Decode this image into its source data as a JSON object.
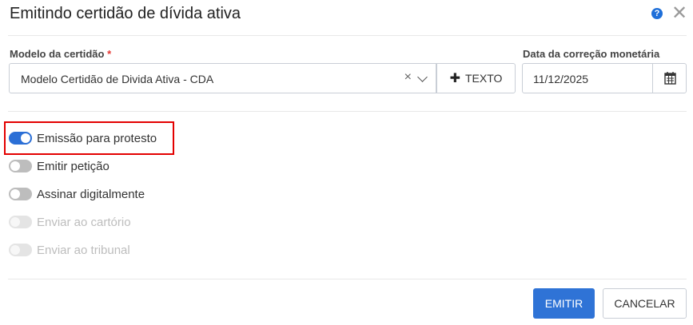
{
  "dialog": {
    "title": "Emitindo certidão de dívida ativa",
    "help_icon": "question-circle-icon",
    "close_icon": "close-icon"
  },
  "form": {
    "modelo_label": "Modelo da certidão",
    "required_mark": "*",
    "modelo_value": "Modelo Certidão de Divida Ativa - CDA",
    "clear_icon": "×",
    "texto_button": "TEXTO",
    "data_label": "Data da correção monetária",
    "data_value": "11/12/2025",
    "calendar_icon": "calendar-icon"
  },
  "toggles": [
    {
      "label": "Emissão para protesto",
      "state": "on",
      "enabled": true
    },
    {
      "label": "Emitir petição",
      "state": "off",
      "enabled": true
    },
    {
      "label": "Assinar digitalmente",
      "state": "off",
      "enabled": true
    },
    {
      "label": "Enviar ao cartório",
      "state": "off",
      "enabled": false
    },
    {
      "label": "Enviar ao tribunal",
      "state": "off",
      "enabled": false
    }
  ],
  "footer": {
    "emitir_label": "EMITIR",
    "cancelar_label": "CANCELAR"
  },
  "colors": {
    "primary": "#2f73d6",
    "highlight_border": "#e30000",
    "required": "#e53935"
  }
}
